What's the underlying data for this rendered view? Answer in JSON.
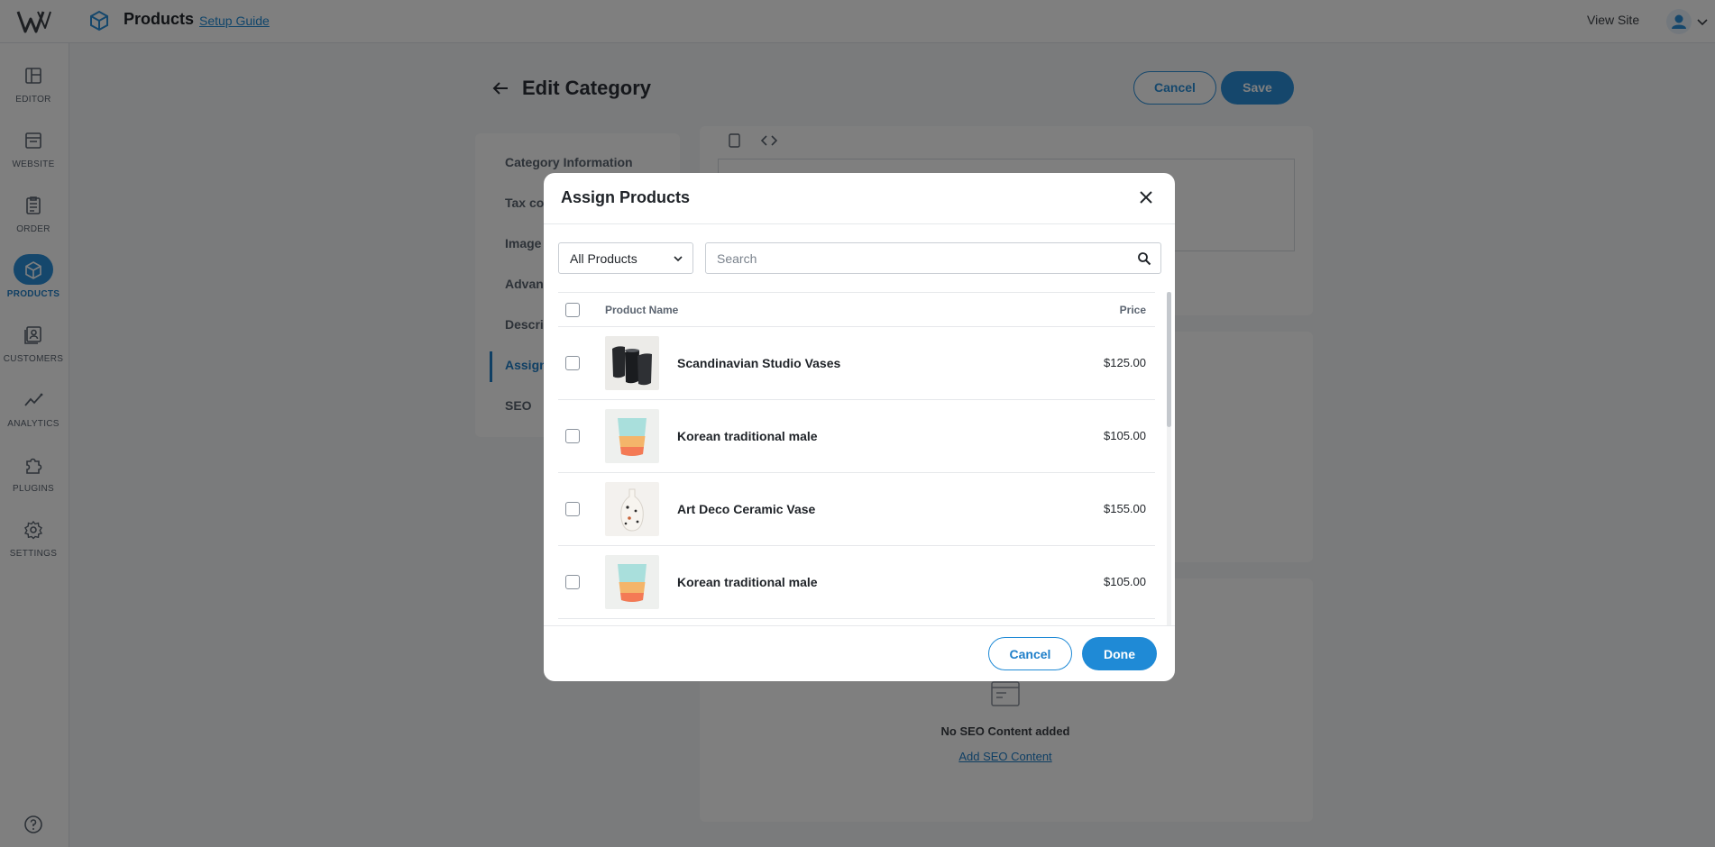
{
  "topbar": {
    "title": "Products",
    "setup_link": "Setup Guide",
    "view_site": "View Site"
  },
  "rail": {
    "items": [
      {
        "label": "EDITOR",
        "icon": "editor-icon"
      },
      {
        "label": "WEBSITE",
        "icon": "website-icon"
      },
      {
        "label": "ORDER",
        "icon": "order-icon"
      },
      {
        "label": "PRODUCTS",
        "icon": "products-icon",
        "active": true
      },
      {
        "label": "CUSTOMERS",
        "icon": "customers-icon"
      },
      {
        "label": "ANALYTICS",
        "icon": "analytics-icon"
      },
      {
        "label": "PLUGINS",
        "icon": "plugins-icon"
      },
      {
        "label": "SETTINGS",
        "icon": "settings-icon"
      }
    ]
  },
  "page": {
    "title": "Edit Category",
    "cancel_label": "Cancel",
    "save_label": "Save",
    "nav": [
      "Category Information",
      "Tax con",
      "Image",
      "Advanc",
      "Descri",
      "Assign",
      "SEO"
    ],
    "seo_empty": "No SEO Content added",
    "seo_add": "Add SEO Content"
  },
  "modal": {
    "title": "Assign Products",
    "filter_value": "All Products",
    "search_placeholder": "Search",
    "columns": {
      "name": "Product Name",
      "price": "Price"
    },
    "products": [
      {
        "name": "Scandinavian Studio Vases",
        "price": "$125.00"
      },
      {
        "name": "Korean traditional male",
        "price": "$105.00"
      },
      {
        "name": "Art Deco Ceramic Vase",
        "price": "$155.00"
      },
      {
        "name": "Korean traditional male",
        "price": "$105.00"
      }
    ],
    "cancel_label": "Cancel",
    "done_label": "Done"
  },
  "colors": {
    "accent": "#1f8ad6",
    "overlay": "rgba(0,0,0,0.5)"
  }
}
